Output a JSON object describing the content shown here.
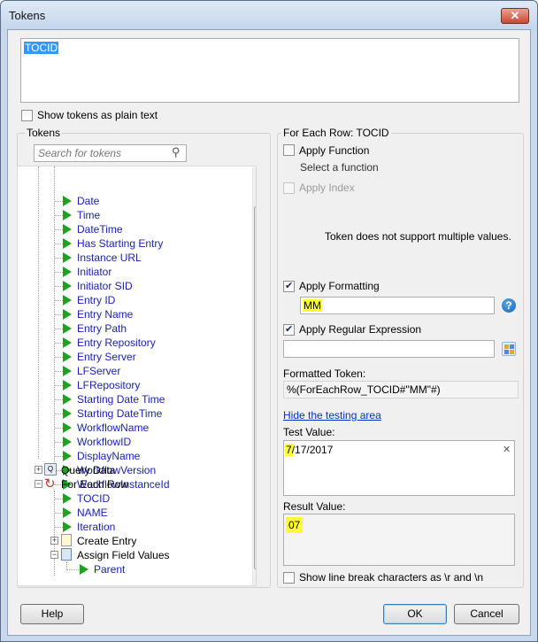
{
  "window": {
    "title": "Tokens",
    "close_glyph": "✕"
  },
  "token_text": "TOCID",
  "show_plain_text_label": "Show tokens as plain text",
  "left_panel": {
    "group_title": "Tokens",
    "search_placeholder": "Search for tokens",
    "tokens": [
      "Date",
      "Time",
      "DateTime",
      "Has Starting Entry",
      "Instance URL",
      "Initiator",
      "Initiator SID",
      "Entry ID",
      "Entry Name",
      "Entry Path",
      "Entry Repository",
      "Entry Server",
      "LFServer",
      "LFRepository",
      "Starting Date Time",
      "Starting DateTime",
      "WorkflowName",
      "WorkflowID",
      "DisplayName",
      "WorkflowVersion",
      "WorkflowInstanceId"
    ],
    "query_data": "Query Data",
    "for_each_row": "For Each Row",
    "for_each_children": [
      "TOCID",
      "NAME",
      "Iteration"
    ],
    "create_entry": "Create Entry",
    "assign_field_values": "Assign Field Values",
    "parent": "Parent"
  },
  "right_panel": {
    "group_title": "For Each Row: TOCID",
    "apply_function_label": "Apply Function",
    "select_function": "Select a function",
    "apply_index_label": "Apply Index",
    "multi_values_note": "Token does not support multiple values.",
    "apply_formatting_label": "Apply Formatting",
    "apply_formatting_checked": true,
    "format_value": "MM",
    "apply_regex_label": "Apply Regular Expression",
    "apply_regex_checked": true,
    "regex_value": "",
    "formatted_token_label": "Formatted Token:",
    "formatted_token_value": "%(ForEachRow_TOCID#\"MM\"#)",
    "hide_testing_link": "Hide the testing area",
    "test_value_label": "Test Value:",
    "test_value": "7/17/2017",
    "clear_glyph": "✕",
    "result_value_label": "Result Value:",
    "result_value": "07",
    "line_break_label": "Show line break characters as \\r and \\n"
  },
  "buttons": {
    "help": "Help",
    "ok": "OK",
    "cancel": "Cancel"
  },
  "colors": {
    "token_link": "#1a22b8",
    "highlight": "#ffff33",
    "link": "#0033cc"
  }
}
